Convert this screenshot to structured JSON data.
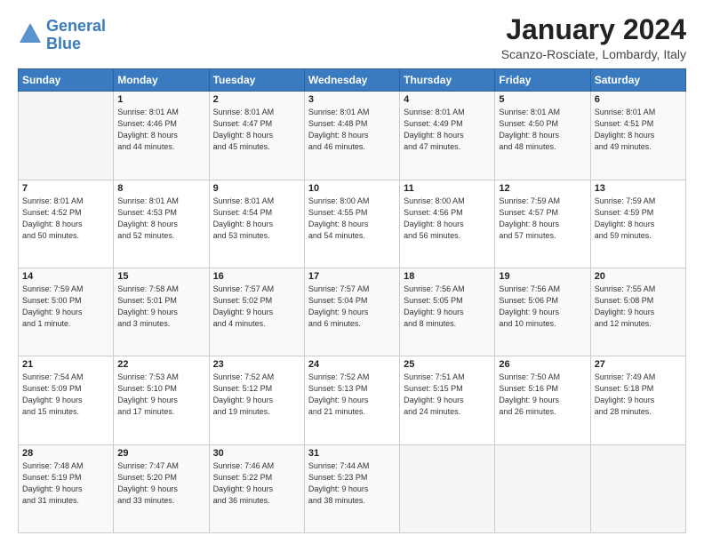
{
  "header": {
    "logo": {
      "line1": "General",
      "line2": "Blue"
    },
    "title": "January 2024",
    "location": "Scanzo-Rosciate, Lombardy, Italy"
  },
  "days_of_week": [
    "Sunday",
    "Monday",
    "Tuesday",
    "Wednesday",
    "Thursday",
    "Friday",
    "Saturday"
  ],
  "weeks": [
    [
      {
        "day": "",
        "info": ""
      },
      {
        "day": "1",
        "info": "Sunrise: 8:01 AM\nSunset: 4:46 PM\nDaylight: 8 hours\nand 44 minutes."
      },
      {
        "day": "2",
        "info": "Sunrise: 8:01 AM\nSunset: 4:47 PM\nDaylight: 8 hours\nand 45 minutes."
      },
      {
        "day": "3",
        "info": "Sunrise: 8:01 AM\nSunset: 4:48 PM\nDaylight: 8 hours\nand 46 minutes."
      },
      {
        "day": "4",
        "info": "Sunrise: 8:01 AM\nSunset: 4:49 PM\nDaylight: 8 hours\nand 47 minutes."
      },
      {
        "day": "5",
        "info": "Sunrise: 8:01 AM\nSunset: 4:50 PM\nDaylight: 8 hours\nand 48 minutes."
      },
      {
        "day": "6",
        "info": "Sunrise: 8:01 AM\nSunset: 4:51 PM\nDaylight: 8 hours\nand 49 minutes."
      }
    ],
    [
      {
        "day": "7",
        "info": "Sunrise: 8:01 AM\nSunset: 4:52 PM\nDaylight: 8 hours\nand 50 minutes."
      },
      {
        "day": "8",
        "info": "Sunrise: 8:01 AM\nSunset: 4:53 PM\nDaylight: 8 hours\nand 52 minutes."
      },
      {
        "day": "9",
        "info": "Sunrise: 8:01 AM\nSunset: 4:54 PM\nDaylight: 8 hours\nand 53 minutes."
      },
      {
        "day": "10",
        "info": "Sunrise: 8:00 AM\nSunset: 4:55 PM\nDaylight: 8 hours\nand 54 minutes."
      },
      {
        "day": "11",
        "info": "Sunrise: 8:00 AM\nSunset: 4:56 PM\nDaylight: 8 hours\nand 56 minutes."
      },
      {
        "day": "12",
        "info": "Sunrise: 7:59 AM\nSunset: 4:57 PM\nDaylight: 8 hours\nand 57 minutes."
      },
      {
        "day": "13",
        "info": "Sunrise: 7:59 AM\nSunset: 4:59 PM\nDaylight: 8 hours\nand 59 minutes."
      }
    ],
    [
      {
        "day": "14",
        "info": "Sunrise: 7:59 AM\nSunset: 5:00 PM\nDaylight: 9 hours\nand 1 minute."
      },
      {
        "day": "15",
        "info": "Sunrise: 7:58 AM\nSunset: 5:01 PM\nDaylight: 9 hours\nand 3 minutes."
      },
      {
        "day": "16",
        "info": "Sunrise: 7:57 AM\nSunset: 5:02 PM\nDaylight: 9 hours\nand 4 minutes."
      },
      {
        "day": "17",
        "info": "Sunrise: 7:57 AM\nSunset: 5:04 PM\nDaylight: 9 hours\nand 6 minutes."
      },
      {
        "day": "18",
        "info": "Sunrise: 7:56 AM\nSunset: 5:05 PM\nDaylight: 9 hours\nand 8 minutes."
      },
      {
        "day": "19",
        "info": "Sunrise: 7:56 AM\nSunset: 5:06 PM\nDaylight: 9 hours\nand 10 minutes."
      },
      {
        "day": "20",
        "info": "Sunrise: 7:55 AM\nSunset: 5:08 PM\nDaylight: 9 hours\nand 12 minutes."
      }
    ],
    [
      {
        "day": "21",
        "info": "Sunrise: 7:54 AM\nSunset: 5:09 PM\nDaylight: 9 hours\nand 15 minutes."
      },
      {
        "day": "22",
        "info": "Sunrise: 7:53 AM\nSunset: 5:10 PM\nDaylight: 9 hours\nand 17 minutes."
      },
      {
        "day": "23",
        "info": "Sunrise: 7:52 AM\nSunset: 5:12 PM\nDaylight: 9 hours\nand 19 minutes."
      },
      {
        "day": "24",
        "info": "Sunrise: 7:52 AM\nSunset: 5:13 PM\nDaylight: 9 hours\nand 21 minutes."
      },
      {
        "day": "25",
        "info": "Sunrise: 7:51 AM\nSunset: 5:15 PM\nDaylight: 9 hours\nand 24 minutes."
      },
      {
        "day": "26",
        "info": "Sunrise: 7:50 AM\nSunset: 5:16 PM\nDaylight: 9 hours\nand 26 minutes."
      },
      {
        "day": "27",
        "info": "Sunrise: 7:49 AM\nSunset: 5:18 PM\nDaylight: 9 hours\nand 28 minutes."
      }
    ],
    [
      {
        "day": "28",
        "info": "Sunrise: 7:48 AM\nSunset: 5:19 PM\nDaylight: 9 hours\nand 31 minutes."
      },
      {
        "day": "29",
        "info": "Sunrise: 7:47 AM\nSunset: 5:20 PM\nDaylight: 9 hours\nand 33 minutes."
      },
      {
        "day": "30",
        "info": "Sunrise: 7:46 AM\nSunset: 5:22 PM\nDaylight: 9 hours\nand 36 minutes."
      },
      {
        "day": "31",
        "info": "Sunrise: 7:44 AM\nSunset: 5:23 PM\nDaylight: 9 hours\nand 38 minutes."
      },
      {
        "day": "",
        "info": ""
      },
      {
        "day": "",
        "info": ""
      },
      {
        "day": "",
        "info": ""
      }
    ]
  ]
}
